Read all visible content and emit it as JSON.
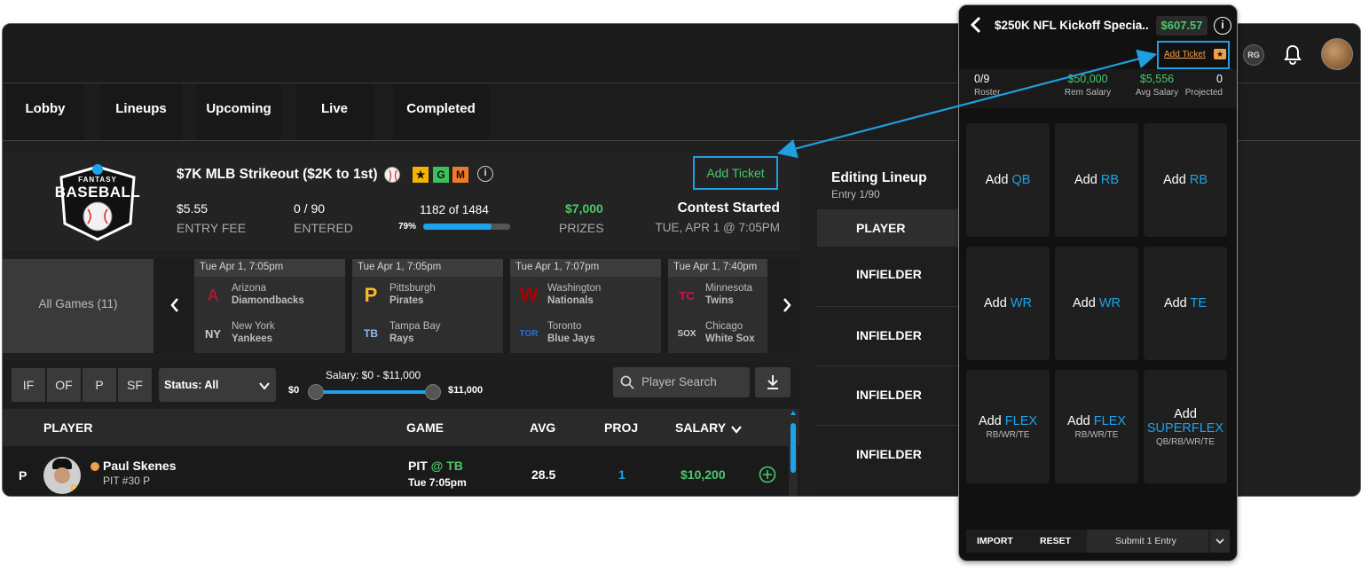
{
  "nav": {
    "tabs": [
      "Lobby",
      "Lineups",
      "Upcoming",
      "Live",
      "Completed"
    ]
  },
  "header": {
    "rg_badge": "RG"
  },
  "contest": {
    "logo_top": "FANTASY",
    "logo_main": "BASEBALL",
    "title": "$7K MLB Strikeout ($2K to 1st)",
    "badges": [
      "★",
      "G",
      "M"
    ],
    "add_ticket": "Add Ticket",
    "entry_fee": "$5.55",
    "entry_fee_label": "ENTRY FEE",
    "entered": "0 / 90",
    "entered_label": "ENTERED",
    "fill": "1182 of 1484",
    "fill_pct": "79%",
    "fill_fraction": 0.79,
    "prizes": "$7,000",
    "prizes_label": "PRIZES",
    "status": "Contest Started",
    "start": "TUE, APR 1 @ 7:05PM"
  },
  "games": {
    "all_label": "All Games (11)",
    "cards": [
      {
        "time": "Tue Apr 1, 7:05pm",
        "away": {
          "city": "Arizona",
          "nick": "Diamondbacks",
          "logo": "A",
          "color": "#a71930"
        },
        "home": {
          "city": "New York",
          "nick": "Yankees",
          "logo": "NY",
          "color": "#c4ced4"
        }
      },
      {
        "time": "Tue Apr 1, 7:05pm",
        "away": {
          "city": "Pittsburgh",
          "nick": "Pirates",
          "logo": "P",
          "color": "#fdb827"
        },
        "home": {
          "city": "Tampa Bay",
          "nick": "Rays",
          "logo": "TB",
          "color": "#8fbce6"
        }
      },
      {
        "time": "Tue Apr 1, 7:07pm",
        "away": {
          "city": "Washington",
          "nick": "Nationals",
          "logo": "W",
          "color": "#ab0003"
        },
        "home": {
          "city": "Toronto",
          "nick": "Blue Jays",
          "logo": "TOR",
          "color": "#134a8e"
        }
      },
      {
        "time": "Tue Apr 1, 7:40pm",
        "away": {
          "city": "Minnesota",
          "nick": "Twins",
          "logo": "TC",
          "color": "#d31145"
        },
        "home": {
          "city": "Chicago",
          "nick": "White Sox",
          "logo": "SOX",
          "color": "#c4ced4"
        }
      }
    ]
  },
  "filters": {
    "positions": [
      "IF",
      "OF",
      "P",
      "SF"
    ],
    "status_label": "Status: All",
    "salary_label": "Salary: $0 - $11,000",
    "salary_min": "$0",
    "salary_max": "$11,000",
    "search_placeholder": "Player Search"
  },
  "table": {
    "headers": {
      "player": "PLAYER",
      "game": "GAME",
      "avg": "AVG",
      "proj": "PROJ",
      "salary": "SALARY"
    },
    "rows": [
      {
        "pos": "P",
        "name": "Paul Skenes",
        "meta": "PIT #30 P",
        "game_away": "PIT",
        "game_at": "@",
        "game_home": "TB",
        "game_time": "Tue 7:05pm",
        "avg": "28.5",
        "proj": "1",
        "salary": "$10,200"
      }
    ]
  },
  "lineup_panel": {
    "title": "Editing Lineup",
    "subtitle": "Entry 1/90",
    "header": "PLAYER",
    "slots": [
      "INFIELDER",
      "INFIELDER",
      "INFIELDER",
      "INFIELDER"
    ]
  },
  "mobile": {
    "title": "$250K NFL Kickoff Specia..",
    "balance": "$607.57",
    "add_ticket": "Add Ticket",
    "ticket_badge": "★",
    "stats": [
      {
        "value": "0/9",
        "label": "Roster"
      },
      {
        "value": "$50,000",
        "label": "Rem Salary"
      },
      {
        "value": "$5,556",
        "label": "Avg Salary"
      },
      {
        "value": "0",
        "label": "Projected"
      }
    ],
    "slots": [
      {
        "add": "Add",
        "pos": "QB",
        "sub": ""
      },
      {
        "add": "Add",
        "pos": "RB",
        "sub": ""
      },
      {
        "add": "Add",
        "pos": "RB",
        "sub": ""
      },
      {
        "add": "Add",
        "pos": "WR",
        "sub": ""
      },
      {
        "add": "Add",
        "pos": "WR",
        "sub": ""
      },
      {
        "add": "Add",
        "pos": "TE",
        "sub": ""
      },
      {
        "add": "Add",
        "pos": "FLEX",
        "sub": "RB/WR/TE"
      },
      {
        "add": "Add",
        "pos": "FLEX",
        "sub": "RB/WR/TE"
      },
      {
        "add": "Add",
        "pos": "SUPERFLEX",
        "sub": "QB/RB/WR/TE"
      }
    ],
    "import": "IMPORT",
    "reset": "RESET",
    "submit": "Submit 1 Entry"
  },
  "colors": {
    "accent_green": "#4bc96b",
    "accent_blue": "#1ca3ec",
    "callout": "#1f9fe0"
  }
}
